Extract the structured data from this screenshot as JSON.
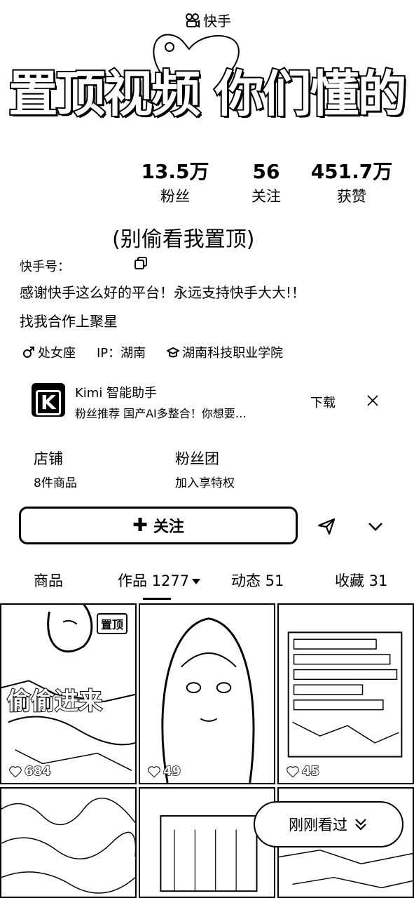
{
  "banner": {
    "logo_text": "快手",
    "headline": "置顶视频 你们懂的"
  },
  "stats": [
    {
      "value": "13.5万",
      "label": "粉丝"
    },
    {
      "value": "56",
      "label": "关注"
    },
    {
      "value": "451.7万",
      "label": "获赞"
    }
  ],
  "profile": {
    "nickname": "(别偷看我置顶)",
    "kuaishou_id_label": "快手号：",
    "bio_line1": "感谢快手这么好的平台！永远支持快手大大!！",
    "bio_line2": "找我合作上聚星",
    "tags": [
      "处女座",
      "IP：湖南",
      "湖南科技职业学院"
    ]
  },
  "ad": {
    "logo_letter": "K",
    "title": "Kimi 智能助手",
    "description": "粉丝推荐  国产AI多整合！你想要…",
    "download_label": "下载"
  },
  "shop": {
    "title": "店铺",
    "subtitle": "8件商品"
  },
  "fan_club": {
    "title": "粉丝团",
    "subtitle": "加入享特权"
  },
  "follow_button": {
    "label": "关注"
  },
  "tabs": [
    {
      "label": "商品"
    },
    {
      "label": "作品 1277"
    },
    {
      "label": "动态 51"
    },
    {
      "label": "收藏 31"
    }
  ],
  "videos": [
    {
      "pinned_label": "置顶",
      "caption": "偷偷进来",
      "likes": "684"
    },
    {
      "likes": "49"
    },
    {
      "likes": "45"
    }
  ],
  "recently_viewed": {
    "label": "刚刚看过"
  }
}
